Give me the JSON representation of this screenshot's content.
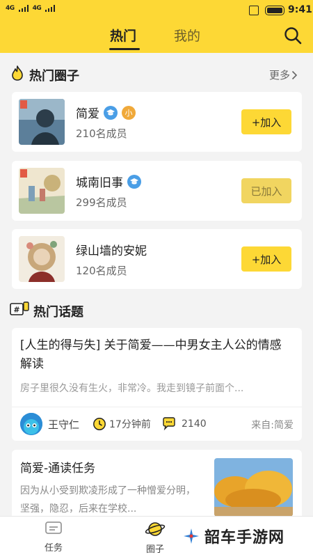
{
  "status_bar": {
    "signal_1": "4G",
    "signal_2": "4G",
    "time": "9:41"
  },
  "header": {
    "tabs": [
      {
        "label": "热门",
        "active": true
      },
      {
        "label": "我的",
        "active": false
      }
    ],
    "search_icon": "search-icon"
  },
  "hot_circles": {
    "title": "热门圈子",
    "more_label": "更多",
    "items": [
      {
        "name": "简爱",
        "badges": [
          "edu-badge",
          "小"
        ],
        "members": "210名成员",
        "action": "+加入",
        "joined": false
      },
      {
        "name": "城南旧事",
        "badges": [
          "edu-badge"
        ],
        "members": "299名成员",
        "action": "已加入",
        "joined": true
      },
      {
        "name": "绿山墙的安妮",
        "badges": [],
        "members": "120名成员",
        "action": "+加入",
        "joined": false
      }
    ]
  },
  "hot_topics": {
    "title": "热门话题",
    "items": [
      {
        "title": "[人生的得与失] 关于简爱——中男女主人公的情感解读",
        "excerpt": "房子里很久没有生火，非常冷。我走到镜子前面个...",
        "author": "王守仁",
        "time": "17分钟前",
        "comments": "2140",
        "source": "来自:简爱"
      },
      {
        "title": "简爱-通读任务",
        "excerpt": "因为从小受到欺凌形成了一种憎爱分明，坚强，隐忍，后来在学校..."
      }
    ]
  },
  "bottom_nav": [
    {
      "label": "任务",
      "icon": "task-icon"
    },
    {
      "label": "圈子",
      "icon": "planet-icon",
      "active": true
    }
  ],
  "watermark": {
    "text": "韶车手游网"
  },
  "colors": {
    "accent": "#fdd835",
    "badge_blue": "#4a9ee6",
    "badge_orange": "#f0a93a"
  }
}
